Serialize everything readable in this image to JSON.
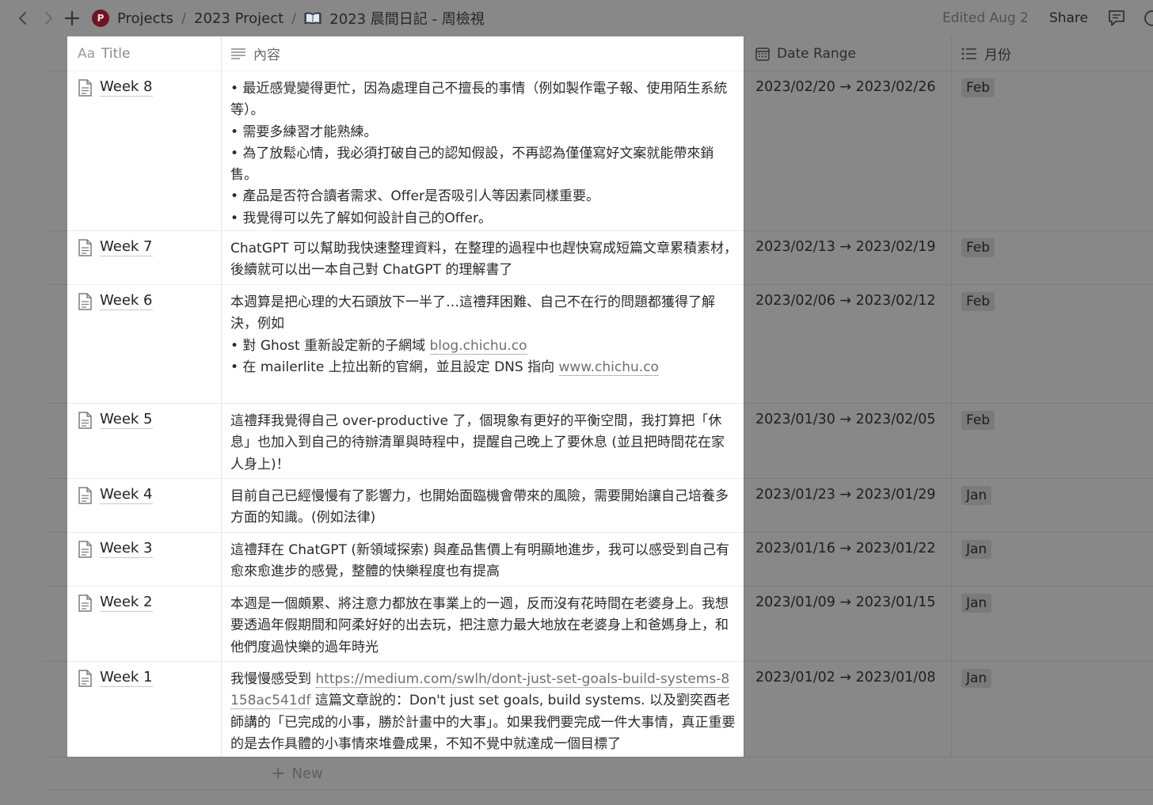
{
  "topbar": {
    "workspace_initial": "P",
    "breadcrumbs": [
      "Projects",
      "2023 Project",
      "2023 晨間日記 - 周檢視"
    ],
    "separator": "/",
    "edited": "Edited Aug 2",
    "share": "Share"
  },
  "table": {
    "headers": {
      "title_prefix": "Aa",
      "title": "Title",
      "content": "內容",
      "date": "Date Range",
      "month": "月份"
    },
    "rows": [
      {
        "title": "Week 8",
        "content": [
          "• 最近感覺變得更忙，因為處理自己不擅長的事情（例如製作電子報、使用陌生系統等）。",
          "• 需要多練習才能熟練。",
          "• 為了放鬆心情，我必須打破自己的認知假設，不再認為僅僅寫好文案就能帶來銷售。",
          "• 產品是否符合讀者需求、Offer是否吸引人等因素同樣重要。",
          "• 我覺得可以先了解如何設計自己的Offer。"
        ],
        "date": "2023/02/20 → 2023/02/26",
        "month": "Feb"
      },
      {
        "title": "Week 7",
        "content": [
          "ChatGPT 可以幫助我快速整理資料，在整理的過程中也趕快寫成短篇文章累積素材，後續就可以出一本自己對 ChatGPT 的理解書了"
        ],
        "date": "2023/02/13 → 2023/02/19",
        "month": "Feb"
      },
      {
        "title": "Week 6",
        "content_intro": "本週算是把心理的大石頭放下一半了…這禮拜困難、自己不在行的問題都獲得了解決，例如",
        "bullet1_text": "• 對 Ghost 重新設定新的子網域 ",
        "bullet1_link": "blog.chichu.co",
        "bullet2_text": "• 在 mailerlite 上拉出新的官網，並且設定 DNS 指向 ",
        "bullet2_link": "www.chichu.co",
        "date": "2023/02/06 → 2023/02/12",
        "month": "Feb"
      },
      {
        "title": "Week 5",
        "content": [
          "這禮拜我覺得自己 over-productive 了，個現象有更好的平衡空間，我打算把「休息」也加入到自己的待辦清單與時程中，提醒自己晚上了要休息 (並且把時間花在家人身上)！"
        ],
        "date": "2023/01/30 → 2023/02/05",
        "month": "Feb"
      },
      {
        "title": "Week 4",
        "content": [
          "目前自己已經慢慢有了影響力，也開始面臨機會帶來的風險，需要開始讓自己培養多方面的知識。(例如法律)"
        ],
        "date": "2023/01/23 → 2023/01/29",
        "month": "Jan"
      },
      {
        "title": "Week 3",
        "content": [
          "這禮拜在 ChatGPT (新領域探索) 與產品售價上有明顯地進步，我可以感受到自己有愈來愈進步的感覺，整體的快樂程度也有提高"
        ],
        "date": "2023/01/16 → 2023/01/22",
        "month": "Jan"
      },
      {
        "title": "Week 2",
        "content": [
          "本週是一個頗累、將注意力都放在事業上的一週，反而沒有花時間在老婆身上。我想要透過年假期間和阿柔好好的出去玩，把注意力最大地放在老婆身上和爸媽身上，和他們度過快樂的過年時光"
        ],
        "date": "2023/01/09 → 2023/01/15",
        "month": "Jan"
      },
      {
        "title": "Week 1",
        "content_pre": "我慢慢感受到 ",
        "content_link": "https://medium.com/swlh/dont-just-set-goals-build-systems-8158ac541df",
        "content_post": " 這篇文章說的：Don't just set goals, build systems. 以及劉奕酉老師講的「已完成的小事，勝於計畫中的大事」。如果我們要完成一件大事情，真正重要的是去作具體的小事情來堆疊成果，不知不覺中就達成一個目標了",
        "date": "2023/01/02 → 2023/01/08",
        "month": "Jan"
      }
    ],
    "new_label": "New"
  }
}
